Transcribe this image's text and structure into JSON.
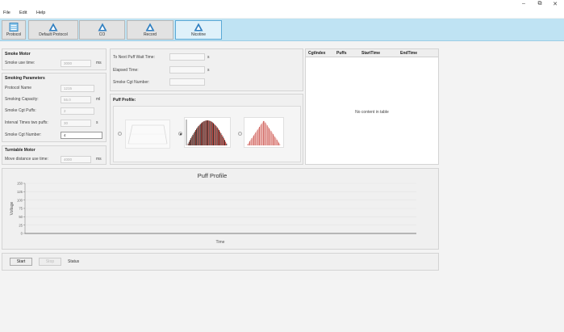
{
  "window": {
    "minimize": "–",
    "maximize": "⧉",
    "close": "✕"
  },
  "menu": [
    "File",
    "Edit",
    "Help"
  ],
  "toolbar": [
    {
      "label": "Protocol",
      "icon": "protocol-icon",
      "active": false
    },
    {
      "label": "Default Protocol",
      "icon": "triangle-logo-icon",
      "active": false
    },
    {
      "label": "CO",
      "icon": "triangle-logo-icon",
      "active": false
    },
    {
      "label": "Record",
      "icon": "triangle-logo-icon",
      "active": false
    },
    {
      "label": "Nicotine",
      "icon": "triangle-logo-icon",
      "active": true
    }
  ],
  "smoke_motor": {
    "title": "Smoke Motor",
    "use_time_label": "Smoke use time:",
    "use_time_value": "3000",
    "use_time_unit": "ms"
  },
  "smoking_params": {
    "title": "Smoking Parameters",
    "protocol_name_label": "Protocol Name",
    "protocol_name_value": "1215",
    "capacity_label": "Smoking Capacity:",
    "capacity_value": "55.0",
    "capacity_unit": "ml",
    "cgt_puffs_label": "Smoke Cgt Puffs:",
    "cgt_puffs_value": "2",
    "interval_label": "Interval Times two puffs:",
    "interval_value": "30",
    "interval_unit": "s",
    "cgt_number_label": "Smoke Cgt Number:",
    "cgt_number_value": "4"
  },
  "turntable": {
    "title": "Turntable Motor",
    "distance_label": "Move distance use time:",
    "distance_value": "4000",
    "distance_unit": "ms"
  },
  "timers": {
    "next_wait_label": "To Next Puff Wait Time:",
    "next_wait_unit": "s",
    "elapsed_label": "Elapsed Time:",
    "elapsed_unit": "s",
    "cgt_number_label": "Smoke Cgt Number:"
  },
  "puff_profile": {
    "title": "Puff Profile:"
  },
  "table": {
    "columns": [
      "CgtIndex",
      "Puffs",
      "StartTime",
      "EndTime"
    ],
    "empty_text": "No content in table"
  },
  "chart_data": {
    "type": "line",
    "title": "Puff Profile",
    "xlabel": "Time",
    "ylabel": "Voltage",
    "yticks": [
      0,
      25,
      50,
      75,
      100,
      125,
      150
    ],
    "ylim": [
      0,
      150
    ],
    "grid": true,
    "series": []
  },
  "controls": {
    "start": "Start",
    "stop": "Stop",
    "status": "Status"
  }
}
